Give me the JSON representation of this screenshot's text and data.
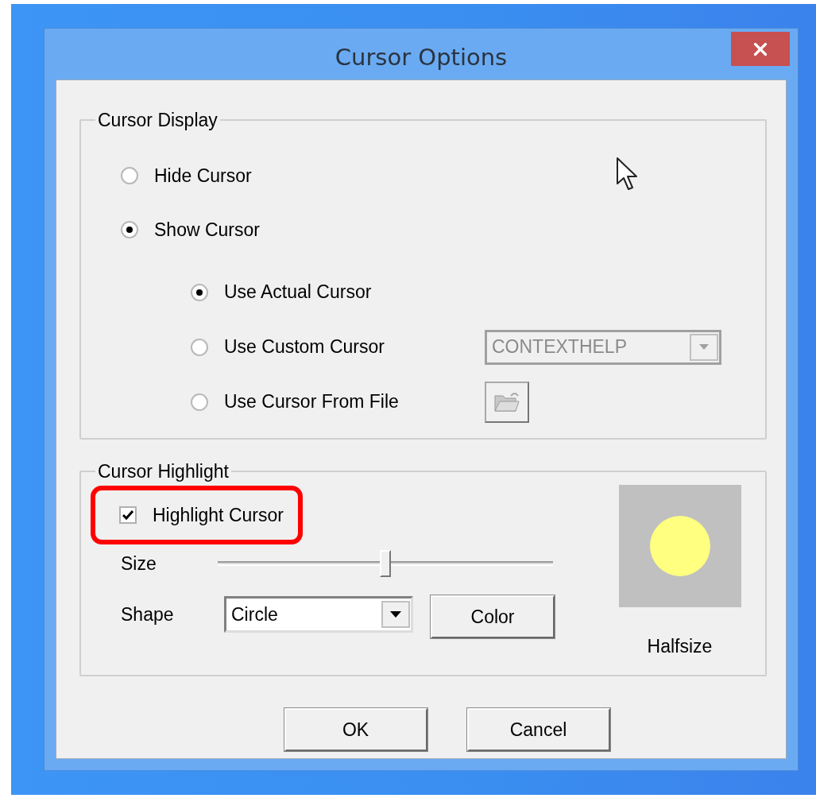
{
  "window": {
    "title": "Cursor Options"
  },
  "cursor_display": {
    "title": "Cursor Display",
    "options": [
      {
        "label": "Hide Cursor",
        "selected": false
      },
      {
        "label": "Show Cursor",
        "selected": true
      }
    ],
    "sub_options": [
      {
        "label": "Use Actual Cursor",
        "selected": true
      },
      {
        "label": "Use Custom Cursor",
        "selected": false,
        "control": {
          "kind": "dropdown",
          "value": "CONTEXTHELP",
          "disabled": true
        }
      },
      {
        "label": "Use Cursor From File",
        "selected": false,
        "control": {
          "kind": "browse"
        }
      }
    ]
  },
  "cursor_highlight": {
    "title": "Cursor Highlight",
    "highlight_checkbox": {
      "label": "Highlight Cursor",
      "checked": true,
      "annotated": true
    },
    "size": {
      "label": "Size",
      "level": 0.5
    },
    "shape": {
      "label": "Shape",
      "value": "Circle"
    },
    "color_button": "Color",
    "preview_caption": "Halfsize"
  },
  "buttons": [
    "OK",
    "Cancel"
  ]
}
